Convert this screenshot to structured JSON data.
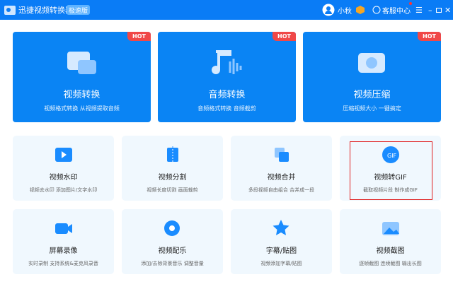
{
  "app": {
    "title": "迅捷视频转换器",
    "edition": "极速版",
    "user": "小秋",
    "support": "客服中心"
  },
  "hot_label": "HOT",
  "big_cards": [
    {
      "title": "视频转换",
      "subtitle": "视频格式转换 从视频提取音频"
    },
    {
      "title": "音频转换",
      "subtitle": "音频格式转换 音频截剪"
    },
    {
      "title": "视频压缩",
      "subtitle": "压缩视频大小 一键搞定"
    }
  ],
  "tools": [
    {
      "title": "视频水印",
      "subtitle": "视频去水印 添加图片/文字水印"
    },
    {
      "title": "视频分割",
      "subtitle": "视频长度切割 画面裁剪"
    },
    {
      "title": "视频合并",
      "subtitle": "多段视频自由组合 合并成一段"
    },
    {
      "title": "视频转GIF",
      "subtitle": "截取视频片段 制作成GIF"
    },
    {
      "title": "屏幕录像",
      "subtitle": "实时录制 支持系统&麦克风录音"
    },
    {
      "title": "视频配乐",
      "subtitle": "添加/去除背景音乐 调整音量"
    },
    {
      "title": "字幕/贴图",
      "subtitle": "视频添加字幕/贴图"
    },
    {
      "title": "视频截图",
      "subtitle": "逐帧截图 连续截图 输出长图"
    }
  ],
  "colors": {
    "primary": "#0a7cf6",
    "hot": "#f04848",
    "selection": "#e02020"
  }
}
